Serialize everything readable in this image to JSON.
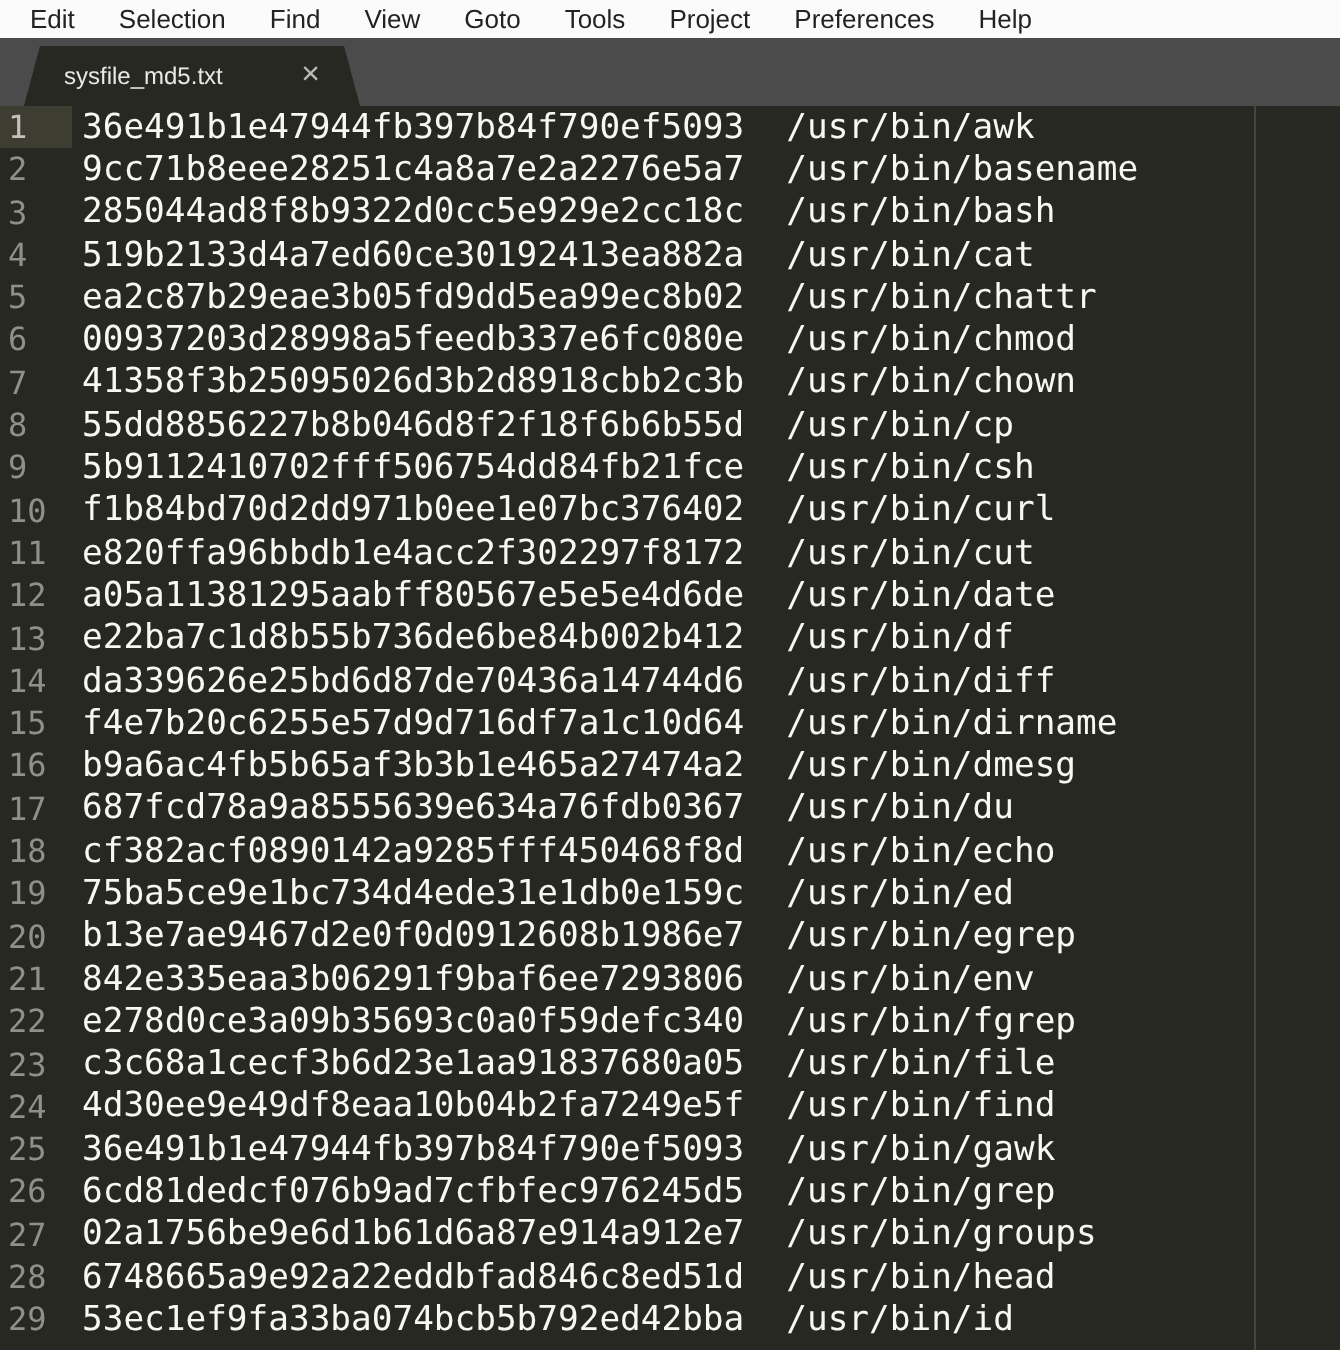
{
  "menu": [
    "Edit",
    "Selection",
    "Find",
    "View",
    "Goto",
    "Tools",
    "Project",
    "Preferences",
    "Help"
  ],
  "tabs": [
    {
      "label": "sysfile_md5.txt",
      "close": "×",
      "selected": true
    }
  ],
  "lines": [
    {
      "number": "1",
      "hash": "36e491b1e47944fb397b84f790ef5093",
      "path": "/usr/bin/awk",
      "current": true
    },
    {
      "number": "2",
      "hash": "9cc71b8eee28251c4a8a7e2a2276e5a7",
      "path": "/usr/bin/basename",
      "current": false
    },
    {
      "number": "3",
      "hash": "285044ad8f8b9322d0cc5e929e2cc18c",
      "path": "/usr/bin/bash",
      "current": false
    },
    {
      "number": "4",
      "hash": "519b2133d4a7ed60ce30192413ea882a",
      "path": "/usr/bin/cat",
      "current": false
    },
    {
      "number": "5",
      "hash": "ea2c87b29eae3b05fd9dd5ea99ec8b02",
      "path": "/usr/bin/chattr",
      "current": false
    },
    {
      "number": "6",
      "hash": "00937203d28998a5feedb337e6fc080e",
      "path": "/usr/bin/chmod",
      "current": false
    },
    {
      "number": "7",
      "hash": "41358f3b25095026d3b2d8918cbb2c3b",
      "path": "/usr/bin/chown",
      "current": false
    },
    {
      "number": "8",
      "hash": "55dd8856227b8b046d8f2f18f6b6b55d",
      "path": "/usr/bin/cp",
      "current": false
    },
    {
      "number": "9",
      "hash": "5b9112410702fff506754dd84fb21fce",
      "path": "/usr/bin/csh",
      "current": false
    },
    {
      "number": "10",
      "hash": "f1b84bd70d2dd971b0ee1e07bc376402",
      "path": "/usr/bin/curl",
      "current": false
    },
    {
      "number": "11",
      "hash": "e820ffa96bbdb1e4acc2f302297f8172",
      "path": "/usr/bin/cut",
      "current": false
    },
    {
      "number": "12",
      "hash": "a05a11381295aabff80567e5e5e4d6de",
      "path": "/usr/bin/date",
      "current": false
    },
    {
      "number": "13",
      "hash": "e22ba7c1d8b55b736de6be84b002b412",
      "path": "/usr/bin/df",
      "current": false
    },
    {
      "number": "14",
      "hash": "da339626e25bd6d87de70436a14744d6",
      "path": "/usr/bin/diff",
      "current": false
    },
    {
      "number": "15",
      "hash": "f4e7b20c6255e57d9d716df7a1c10d64",
      "path": "/usr/bin/dirname",
      "current": false
    },
    {
      "number": "16",
      "hash": "b9a6ac4fb5b65af3b3b1e465a27474a2",
      "path": "/usr/bin/dmesg",
      "current": false
    },
    {
      "number": "17",
      "hash": "687fcd78a9a8555639e634a76fdb0367",
      "path": "/usr/bin/du",
      "current": false
    },
    {
      "number": "18",
      "hash": "cf382acf0890142a9285fff450468f8d",
      "path": "/usr/bin/echo",
      "current": false
    },
    {
      "number": "19",
      "hash": "75ba5ce9e1bc734d4ede31e1db0e159c",
      "path": "/usr/bin/ed",
      "current": false
    },
    {
      "number": "20",
      "hash": "b13e7ae9467d2e0f0d0912608b1986e7",
      "path": "/usr/bin/egrep",
      "current": false
    },
    {
      "number": "21",
      "hash": "842e335eaa3b06291f9baf6ee7293806",
      "path": "/usr/bin/env",
      "current": false
    },
    {
      "number": "22",
      "hash": "e278d0ce3a09b35693c0a0f59defc340",
      "path": "/usr/bin/fgrep",
      "current": false
    },
    {
      "number": "23",
      "hash": "c3c68a1cecf3b6d23e1aa91837680a05",
      "path": "/usr/bin/file",
      "current": false
    },
    {
      "number": "24",
      "hash": "4d30ee9e49df8eaa10b04b2fa7249e5f",
      "path": "/usr/bin/find",
      "current": false
    },
    {
      "number": "25",
      "hash": "36e491b1e47944fb397b84f790ef5093",
      "path": "/usr/bin/gawk",
      "current": false
    },
    {
      "number": "26",
      "hash": "6cd81dedcf076b9ad7cfbfec976245d5",
      "path": "/usr/bin/grep",
      "current": false
    },
    {
      "number": "27",
      "hash": "02a1756be9e6d1b61d6a87e914a912e7",
      "path": "/usr/bin/groups",
      "current": false
    },
    {
      "number": "28",
      "hash": "6748665a9e92a22eddbfad846c8ed51d",
      "path": "/usr/bin/head",
      "current": false
    },
    {
      "number": "29",
      "hash": "53ec1ef9fa33ba074bcb5b792ed42bba",
      "path": "/usr/bin/id",
      "current": false
    }
  ]
}
